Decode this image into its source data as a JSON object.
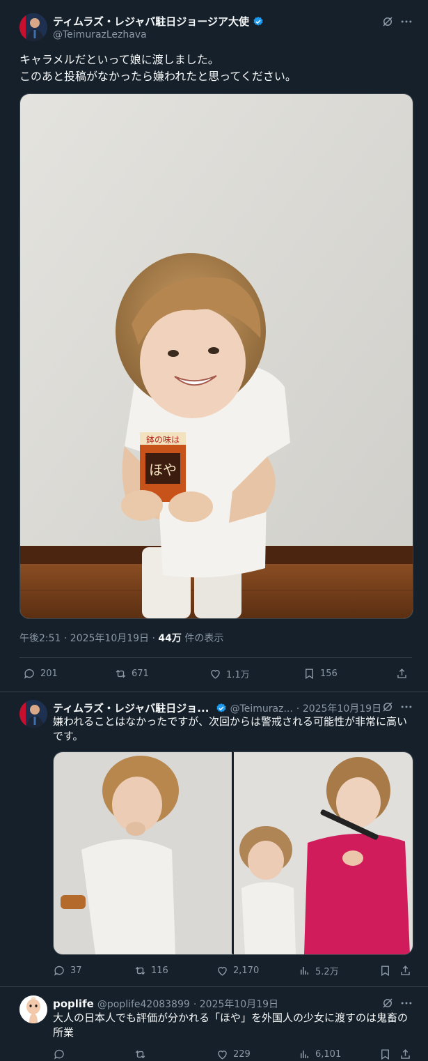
{
  "tweet1": {
    "name": "ティムラズ・レジャバ駐日ジョージア大使",
    "handle": "@TeimurazLezhava",
    "text_line1": "キャラメルだといって娘に渡しました。",
    "text_line2": "このあと投稿がなかったら嫌われたと思ってください。",
    "photo": {
      "box_top": "鉢の味は",
      "box_brand": "ほや"
    },
    "time": "午後2:51 · 2025年10月19日 · ",
    "views": "44万",
    "views_label": " 件の表示",
    "replies": "201",
    "retweets": "671",
    "likes": "1.1万",
    "bookmarks": "156"
  },
  "tweet2": {
    "name": "ティムラズ・レジャバ駐日ジョ...",
    "handle": "@Teimuraz...",
    "date": "· 2025年10月19日",
    "text": "嫌われることはなかったですが、次回からは警戒される可能性が非常に高いです。",
    "replies": "37",
    "retweets": "116",
    "likes": "2,170",
    "views": "5.2万"
  },
  "tweet3": {
    "name": "poplife",
    "handle": "@poplife42083899",
    "date": "· 2025年10月19日",
    "text": "大人の日本人でも評価が分かれる「ほや」を外国人の少女に渡すのは鬼畜の所業",
    "replies": "",
    "retweets": "",
    "likes": "229",
    "views": "6,101"
  },
  "colors": {
    "background": "#15202b",
    "muted": "#8b98a5",
    "verified": "#1d9bf0",
    "divider": "#38444d"
  }
}
